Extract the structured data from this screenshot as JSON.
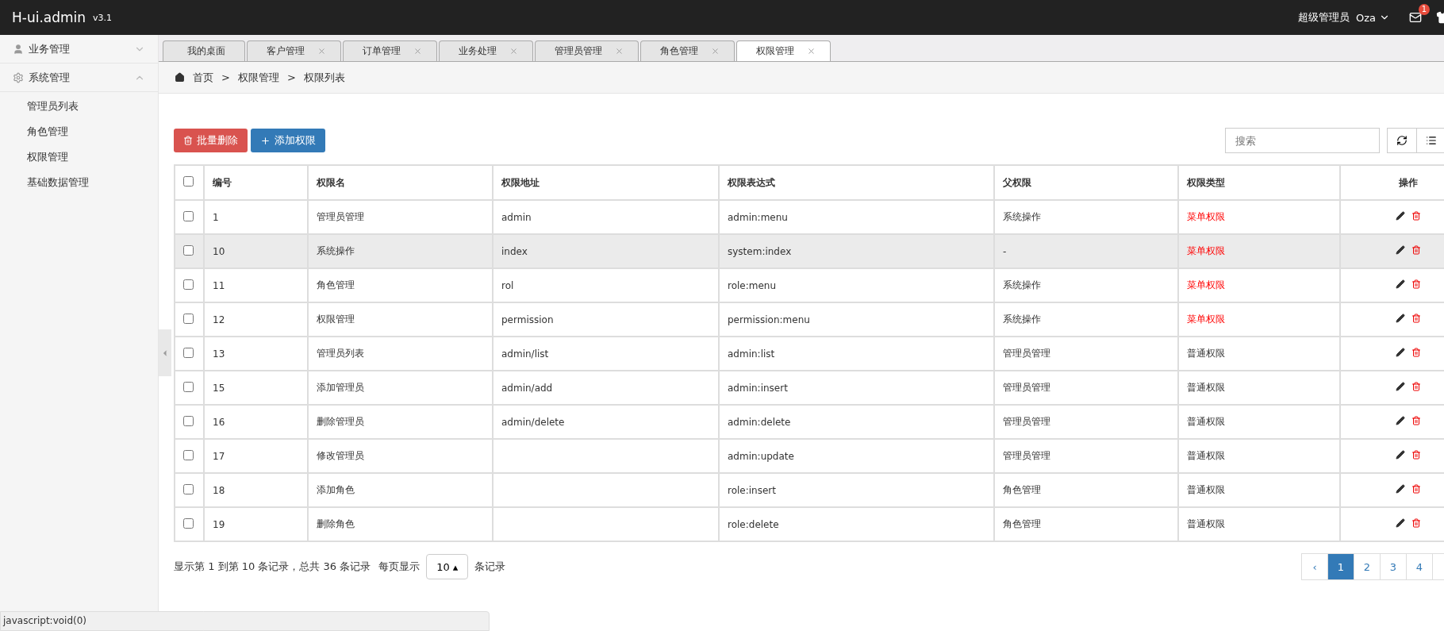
{
  "header": {
    "logo": "H-ui.admin",
    "version": "v3.1",
    "role": "超级管理员",
    "user": "Oza",
    "badge": "1"
  },
  "sidebar": {
    "groups": [
      {
        "label": "业务管理",
        "expanded": false
      },
      {
        "label": "系统管理",
        "expanded": true,
        "children": [
          {
            "label": "管理员列表"
          },
          {
            "label": "角色管理"
          },
          {
            "label": "权限管理"
          },
          {
            "label": "基础数据管理"
          }
        ]
      }
    ]
  },
  "tabs": [
    {
      "label": "我的桌面",
      "closable": false,
      "selected": false
    },
    {
      "label": "客户管理",
      "closable": true,
      "selected": false
    },
    {
      "label": "订单管理",
      "closable": true,
      "selected": false
    },
    {
      "label": "业务处理",
      "closable": true,
      "selected": false
    },
    {
      "label": "管理员管理",
      "closable": true,
      "selected": false
    },
    {
      "label": "角色管理",
      "closable": true,
      "selected": false
    },
    {
      "label": "权限管理",
      "closable": true,
      "selected": true
    }
  ],
  "breadcrumb": [
    "首页",
    "权限管理",
    "权限列表"
  ],
  "separator": ">",
  "buttons": {
    "delete": "批量删除",
    "add": "添加权限"
  },
  "search": {
    "placeholder": "搜索"
  },
  "table": {
    "all_checked": false,
    "columns": [
      "编号",
      "权限名",
      "权限地址",
      "权限表达式",
      "父权限",
      "权限类型",
      "操作"
    ],
    "rows": [
      {
        "checked": false,
        "highlighted": false,
        "id": "1",
        "name": "管理员管理",
        "url": "admin",
        "expr": "admin:menu",
        "parent": "系统操作",
        "type": "菜单权限",
        "kind": "menu"
      },
      {
        "checked": false,
        "highlighted": true,
        "id": "10",
        "name": "系统操作",
        "url": "index",
        "expr": "system:index",
        "parent": "-",
        "type": "菜单权限",
        "kind": "menu"
      },
      {
        "checked": false,
        "highlighted": false,
        "id": "11",
        "name": "角色管理",
        "url": "rol",
        "expr": "role:menu",
        "parent": "系统操作",
        "type": "菜单权限",
        "kind": "menu"
      },
      {
        "checked": false,
        "highlighted": false,
        "id": "12",
        "name": "权限管理",
        "url": "permission",
        "expr": "permission:menu",
        "parent": "系统操作",
        "type": "菜单权限",
        "kind": "menu"
      },
      {
        "checked": false,
        "highlighted": false,
        "id": "13",
        "name": "管理员列表",
        "url": "admin/list",
        "expr": "admin:list",
        "parent": "管理员管理",
        "type": "普通权限",
        "kind": "normal"
      },
      {
        "checked": false,
        "highlighted": false,
        "id": "15",
        "name": "添加管理员",
        "url": "admin/add",
        "expr": "admin:insert",
        "parent": "管理员管理",
        "type": "普通权限",
        "kind": "normal"
      },
      {
        "checked": false,
        "highlighted": false,
        "id": "16",
        "name": "删除管理员",
        "url": "admin/delete",
        "expr": "admin:delete",
        "parent": "管理员管理",
        "type": "普通权限",
        "kind": "normal"
      },
      {
        "checked": false,
        "highlighted": false,
        "id": "17",
        "name": "修改管理员",
        "url": "",
        "expr": "admin:update",
        "parent": "管理员管理",
        "type": "普通权限",
        "kind": "normal"
      },
      {
        "checked": false,
        "highlighted": false,
        "id": "18",
        "name": "添加角色",
        "url": "",
        "expr": "role:insert",
        "parent": "角色管理",
        "type": "普通权限",
        "kind": "normal"
      },
      {
        "checked": false,
        "highlighted": false,
        "id": "19",
        "name": "删除角色",
        "url": "",
        "expr": "role:delete",
        "parent": "角色管理",
        "type": "普通权限",
        "kind": "normal"
      }
    ]
  },
  "footer": {
    "info": "显示第 1 到第 10 条记录，总共 36 条记录",
    "per_page_label": "每页显示",
    "per_page": "10",
    "per_page_caret": "▴",
    "per_page_suffix": "条记录"
  },
  "pagination": [
    {
      "label": "‹",
      "selected": false
    },
    {
      "label": "1",
      "selected": true
    },
    {
      "label": "2",
      "selected": false
    },
    {
      "label": "3",
      "selected": false
    },
    {
      "label": "4",
      "selected": false
    }
  ],
  "status_bar": "javascript:void(0)"
}
